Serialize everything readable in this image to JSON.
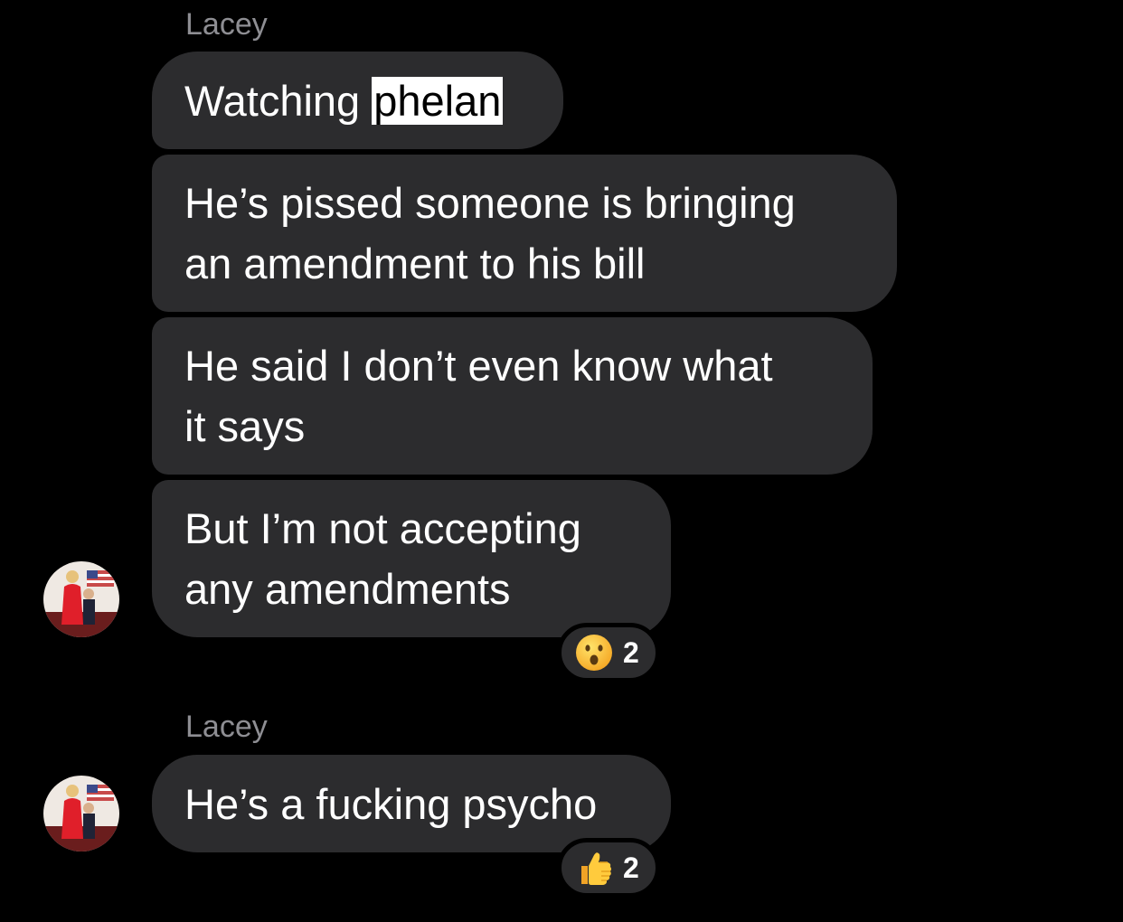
{
  "thread": {
    "groups": [
      {
        "sender": "Lacey",
        "messages": [
          {
            "parts": [
              "Watching ",
              "phelan"
            ]
          },
          {
            "lines": [
              "He’s pissed someone is bringing",
              "an amendment to his bill"
            ]
          },
          {
            "lines": [
              "He said I don’t even know what",
              "it says"
            ]
          },
          {
            "lines": [
              "But I’m not accepting",
              "any amendments"
            ],
            "reaction": {
              "icon": "astonished-face-icon",
              "count": "2"
            }
          }
        ]
      },
      {
        "sender": "Lacey",
        "messages": [
          {
            "lines": [
              "He’s a fucking psycho"
            ],
            "reaction": {
              "icon": "thumbs-up-icon",
              "count": "2"
            }
          }
        ]
      }
    ]
  },
  "colors": {
    "background": "#000000",
    "bubble": "#2c2c2e",
    "sender_name": "#8e8e93",
    "highlight": "#ffffff"
  }
}
